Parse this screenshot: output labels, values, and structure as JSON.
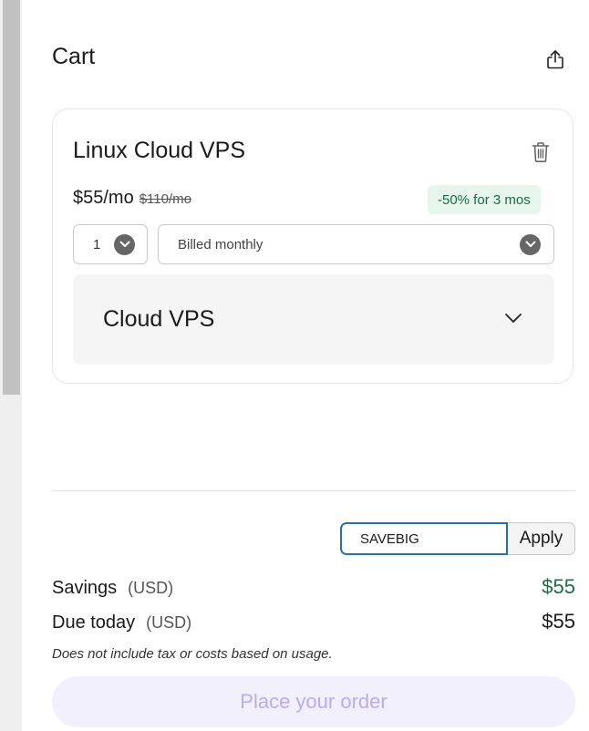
{
  "cart": {
    "title": "Cart",
    "icons": {
      "share": "share-icon",
      "delete": "trash-icon",
      "expand": "chevron-down-icon"
    }
  },
  "item": {
    "name": "Linux Cloud VPS",
    "price": "$55/mo",
    "original_price": "$110/mo",
    "discount_badge": "-50% for 3 mos",
    "quantity": "1",
    "billing": "Billed monthly",
    "accordion_title": "Cloud VPS"
  },
  "coupon": {
    "value": "SAVEBIG",
    "apply_label": "Apply"
  },
  "summary": {
    "savings_label": "Savings",
    "savings_unit": "(USD)",
    "savings_value": "$55",
    "due_label": "Due today",
    "due_unit": "(USD)",
    "due_value": "$55",
    "note": "Does not include tax or costs based on usage."
  },
  "order_button": {
    "label": "Place your order"
  },
  "colors": {
    "accent": "#2a70a8",
    "badge_bg": "#e6f6ed",
    "badge_text": "#1e6b45",
    "savings": "#1e6b45",
    "order_button_bg": "#f3f0fe",
    "order_button_text": "#bcaaf2"
  }
}
